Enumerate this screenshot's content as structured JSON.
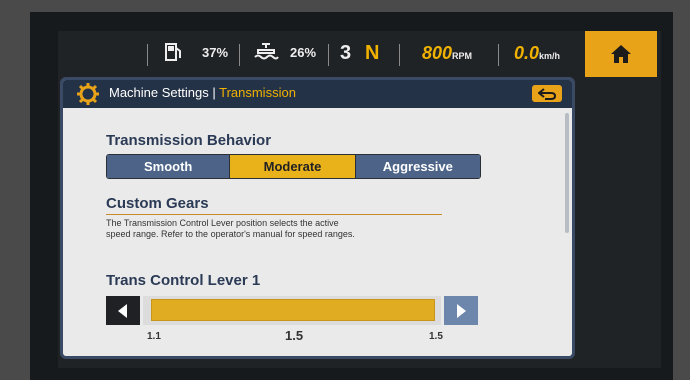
{
  "status": {
    "fuel_pct": "37%",
    "def_pct": "26%",
    "gear_number": "3",
    "gear_mode": "N",
    "rpm_value": "800",
    "rpm_unit": "RPM",
    "speed_value": "0.0",
    "speed_unit": "km/h"
  },
  "panel": {
    "title_prefix": "Machine Settings",
    "title_separator": " | ",
    "title_section": "Transmission"
  },
  "behavior": {
    "heading": "Transmission Behavior",
    "options": [
      "Smooth",
      "Moderate",
      "Aggressive"
    ],
    "selected": "Moderate"
  },
  "custom_gears": {
    "heading": "Custom Gears",
    "description_line1": "The Transmission Control Lever position selects the active",
    "description_line2": "speed range. Refer to the operator's manual for speed ranges."
  },
  "lever": {
    "heading": "Trans Control Lever 1",
    "min_label": "1.1",
    "current_label": "1.5",
    "max_label": "1.5",
    "value_fraction": 1.0
  },
  "colors": {
    "accent": "#e9a319",
    "panel_header": "#243248",
    "segment": "#4d6488"
  }
}
